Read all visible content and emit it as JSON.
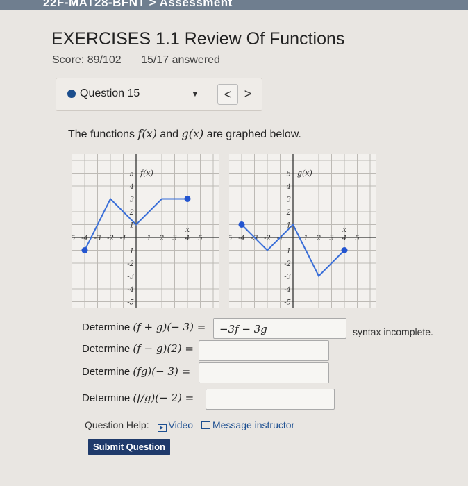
{
  "header": {
    "breadcrumb": "22F-MAT28-BFNT > Assessment"
  },
  "assignment": {
    "title": "EXERCISES 1.1 Review Of Functions",
    "score": "Score: 89/102",
    "answered": "15/17 answered"
  },
  "question_nav": {
    "label": "Question 15",
    "prev": "<",
    "next": ">"
  },
  "question": {
    "intro_pre": "The functions ",
    "f": "f(x)",
    "intro_and": " and ",
    "g": "g(x)",
    "intro_post": " are graphed below."
  },
  "graphs": [
    {
      "label": "f(x)",
      "x_axis_label": "x",
      "x_ticks": [
        "-5",
        "-4",
        "-3",
        "-2",
        "-1",
        "1",
        "2",
        "3",
        "4",
        "5"
      ],
      "y_ticks": [
        "5",
        "4",
        "3",
        "2",
        "1",
        "-1",
        "-2",
        "-3",
        "-4",
        "-5"
      ],
      "points": [
        [
          -4,
          -1
        ],
        [
          -2,
          3
        ],
        [
          0,
          1
        ],
        [
          2,
          3
        ],
        [
          4,
          3
        ]
      ],
      "closed_points": [
        [
          -4,
          -1
        ],
        [
          4,
          3
        ]
      ]
    },
    {
      "label": "g(x)",
      "x_axis_label": "x",
      "x_ticks": [
        "-5",
        "-4",
        "-3",
        "-2",
        "-1",
        "1",
        "2",
        "3",
        "4",
        "5"
      ],
      "y_ticks": [
        "5",
        "4",
        "3",
        "2",
        "1",
        "-1",
        "-2",
        "-3",
        "-4",
        "-5"
      ],
      "points": [
        [
          -4,
          1
        ],
        [
          -2,
          -1
        ],
        [
          0,
          1
        ],
        [
          2,
          -3
        ],
        [
          4,
          -1
        ]
      ],
      "closed_points": [
        [
          -4,
          1
        ],
        [
          4,
          -1
        ]
      ]
    }
  ],
  "rows": [
    {
      "label": "Determine",
      "expr": "(f + g)(− 3) =",
      "answer": "−3f − 3g"
    },
    {
      "label": "Determine",
      "expr": "(f − g)(2) =",
      "answer": ""
    },
    {
      "label": "Determine",
      "expr": "(fg)(− 3) =",
      "answer": ""
    },
    {
      "label": "Determine",
      "expr": "(f/g)(− 2) =",
      "answer": ""
    }
  ],
  "feedback": {
    "syntax": "syntax incomplete."
  },
  "help": {
    "label": "Question Help:",
    "video": "Video",
    "message": "Message instructor"
  },
  "submit_label": "Submit Question",
  "colors": {
    "line": "#3a6fd8",
    "point": "#2355d0",
    "button": "#1f3a6b"
  }
}
